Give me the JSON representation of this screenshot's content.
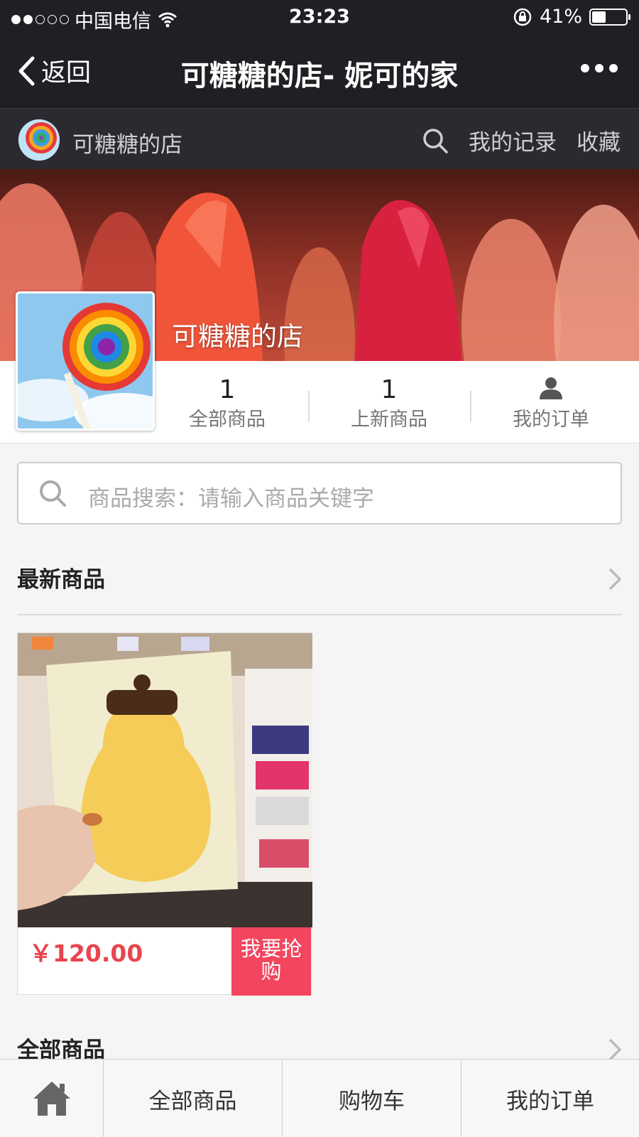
{
  "status_bar": {
    "carrier": "中国电信",
    "time": "23:23",
    "battery_percent": "41%",
    "battery_level": 0.41
  },
  "nav": {
    "back_label": "返回",
    "title": "可糖糖的店- 妮可的家"
  },
  "shop_bar": {
    "shop_name": "可糖糖的店",
    "records_label": "我的记录",
    "favorite_label": "收藏"
  },
  "banner": {
    "shop_name": "可糖糖的店"
  },
  "stats": [
    {
      "value": "1",
      "label": "全部商品"
    },
    {
      "value": "1",
      "label": "上新商品"
    },
    {
      "label": "我的订单"
    }
  ],
  "search": {
    "placeholder": "商品搜索：请输入商品关键字"
  },
  "sections": {
    "latest_title": "最新商品",
    "all_title": "全部商品"
  },
  "products": [
    {
      "price": "￥120.00",
      "buy_label": "我要抢购"
    }
  ],
  "tab_bar": {
    "items": [
      "全部商品",
      "购物车",
      "我的订单"
    ]
  },
  "colors": {
    "nav_bg": "#1f1f24",
    "accent_red": "#f3455e",
    "price_red": "#e8454f"
  }
}
